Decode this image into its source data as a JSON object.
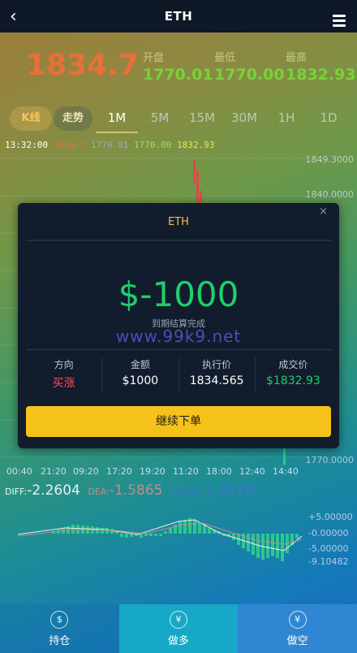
{
  "header": {
    "title": "ETH",
    "back_icon": "back-chevron-icon",
    "menu_icon": "hamburger-menu-icon"
  },
  "ticker": {
    "price": "1834.7",
    "stats": [
      {
        "label": "开盘",
        "value": "1770.01"
      },
      {
        "label": "最低",
        "value": "1770.00"
      },
      {
        "label": "最高",
        "value": "1832.93"
      }
    ]
  },
  "chart_tabs": [
    "K线",
    "走势",
    "1M",
    "5M",
    "15M",
    "30M",
    "1H",
    "1D"
  ],
  "ohlc_row": {
    "time": "13:32:00",
    "v1": "1834.7",
    "v2": "1770.01",
    "v3": "1770.00",
    "v4": "1832.93"
  },
  "y_axis": [
    "1849.3000",
    "1840.0000",
    "1770.0000"
  ],
  "x_axis": [
    "00:40",
    "21:20",
    "09:20",
    "17:20",
    "19:20",
    "11:20",
    "18:00",
    "12:40",
    "14:40"
  ],
  "macd": {
    "diff_label": "DIFF:",
    "diff_value": "-2.2604",
    "dea_label": "DEA:",
    "dea_value": "-1.5865",
    "macd_label": "MACD:",
    "macd_value": "-1.3478",
    "y_labels": [
      "+5.00000",
      "-0.00000",
      "-5.00000",
      "-9.10482"
    ]
  },
  "modal": {
    "title": "ETH",
    "close": "×",
    "result": "$-1000",
    "subtitle": "到期结算完成",
    "watermark": "www.99k9.net",
    "columns": [
      {
        "label": "方向",
        "value": "买涨"
      },
      {
        "label": "金额",
        "value": "$1000"
      },
      {
        "label": "执行价",
        "value": "1834.565"
      },
      {
        "label": "成交价",
        "value": "$1832.93"
      }
    ],
    "button": "继续下单"
  },
  "bottom_nav": [
    {
      "label": "持仓",
      "icon": "coins-icon"
    },
    {
      "label": "做多",
      "icon": "yen-up-icon"
    },
    {
      "label": "做空",
      "icon": "yen-down-icon"
    }
  ],
  "colors": {
    "up": "#e8703a",
    "green": "#78d23a",
    "gold": "#f5c11b",
    "result": "#1ecf6b",
    "buy": "#ff4d5b"
  }
}
